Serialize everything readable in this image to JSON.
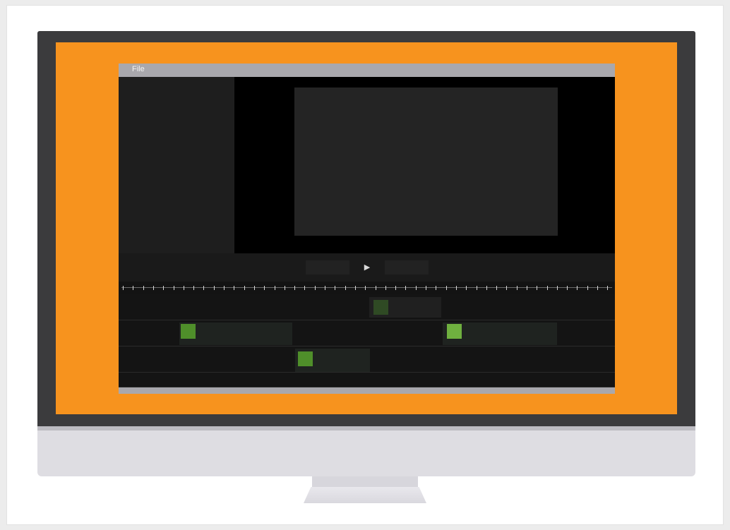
{
  "app": {
    "menu": {
      "file_label": "File"
    },
    "player": {
      "play_icon": "play-icon",
      "play_glyph": "▶"
    }
  },
  "colors": {
    "screen_background": "#f7931e",
    "monitor_bezel": "#3b3b3d",
    "clip_thumbnail": "#4f8f2a",
    "clip_thumbnail_bright": "#6fb03f"
  }
}
